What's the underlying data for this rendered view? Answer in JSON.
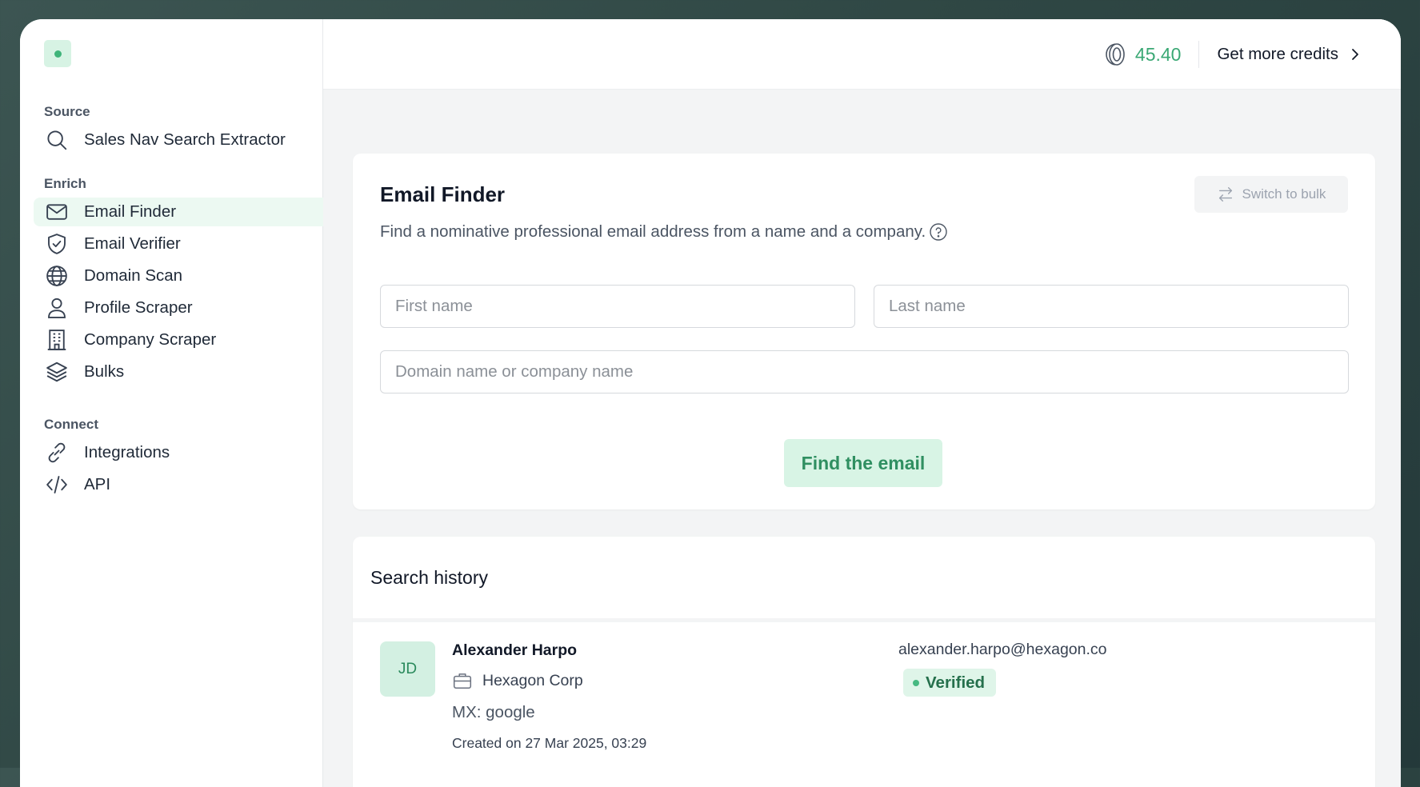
{
  "colors": {
    "accent": "#3fb47a",
    "accent_light": "#d8f4e5",
    "credits_text": "#3aa874",
    "active_nav_bg": "#ecf9f2",
    "verified_bg": "#dff5e9"
  },
  "sidebar": {
    "logo_icon": "app-logo-icon",
    "sections": [
      {
        "title": "Source",
        "items": [
          {
            "label": "Sales Nav Search Extractor",
            "icon": "search-icon",
            "active": false
          }
        ]
      },
      {
        "title": "Enrich",
        "items": [
          {
            "label": "Email Finder",
            "icon": "mail-icon",
            "active": true
          },
          {
            "label": "Email Verifier",
            "icon": "shield-check-icon",
            "active": false
          },
          {
            "label": "Domain Scan",
            "icon": "globe-icon",
            "active": false
          },
          {
            "label": "Profile Scraper",
            "icon": "user-icon",
            "active": false
          },
          {
            "label": "Company Scraper",
            "icon": "building-icon",
            "active": false
          },
          {
            "label": "Bulks",
            "icon": "layers-icon",
            "active": false
          }
        ]
      },
      {
        "title": "Connect",
        "items": [
          {
            "label": "Integrations",
            "icon": "link-icon",
            "active": false
          },
          {
            "label": "API",
            "icon": "code-icon",
            "active": false
          }
        ]
      }
    ]
  },
  "topbar": {
    "credits_icon": "coins-icon",
    "credits": "45.40",
    "get_credits_label": "Get more credits",
    "get_credits_icon": "chevron-right-icon"
  },
  "finder": {
    "title": "Email Finder",
    "description": "Find a nominative professional email address from a name and a company.",
    "help_icon": "question-circle-icon",
    "switch_label": "Switch to bulk",
    "switch_icon": "arrows-swap-icon",
    "first_name_placeholder": "First name",
    "last_name_placeholder": "Last name",
    "domain_placeholder": "Domain name or company name",
    "first_name_value": "",
    "last_name_value": "",
    "domain_value": "",
    "submit_label": "Find the email"
  },
  "history": {
    "title": "Search history",
    "entries": [
      {
        "initials": "JD",
        "name": "Alexander Harpo",
        "company": "Hexagon Corp",
        "company_icon": "briefcase-icon",
        "mx": "MX: google",
        "created": "Created on 27 Mar 2025, 03:29",
        "email": "alexander.harpo@hexagon.co",
        "status": "Verified"
      }
    ]
  }
}
